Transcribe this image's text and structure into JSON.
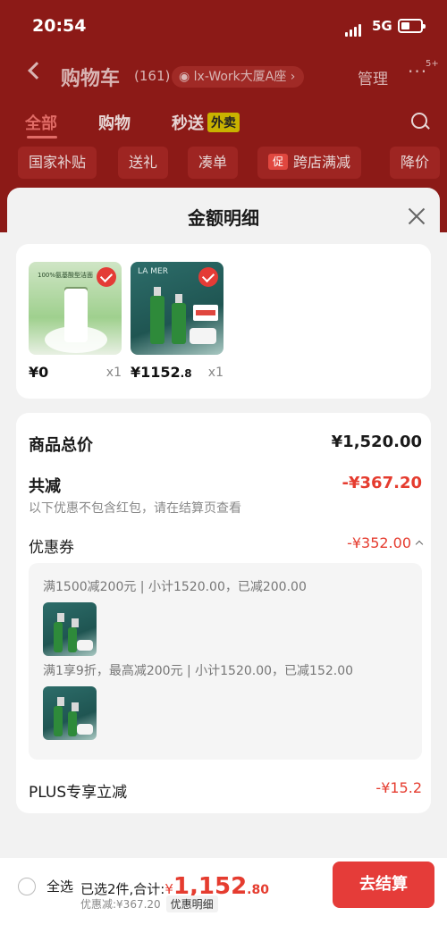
{
  "status_bar": {
    "time": "20:54",
    "network": "5G"
  },
  "header": {
    "title": "购物车",
    "count": "(161)",
    "address": "lx-Work大厦A座",
    "manage": "管理",
    "more_badge": "5+"
  },
  "tabs": [
    {
      "label": "全部"
    },
    {
      "label": "购物"
    },
    {
      "label": "秒送",
      "badge": "外卖"
    }
  ],
  "chips": [
    {
      "label": "国家补贴"
    },
    {
      "label": "送礼"
    },
    {
      "label": "凑单"
    },
    {
      "label": "跨店满减",
      "badge": "促"
    },
    {
      "label": "降价"
    }
  ],
  "sheet": {
    "title": "金额明细",
    "products": [
      {
        "price": "¥0",
        "qty": "x1",
        "thumb_text": "100%氨基酸型洁面"
      },
      {
        "price_int": "¥1152",
        "price_dec": ".8",
        "qty": "x1",
        "thumb_text": "LA MER"
      }
    ],
    "total_label": "商品总价",
    "total_value": "¥1,520.00",
    "reduce_label": "共减",
    "reduce_value": "-¥367.20",
    "reduce_note": "以下优惠不包含红包，请在结算页查看",
    "coupon_label": "优惠券",
    "coupon_value": "-¥352.00",
    "coupon_lines": [
      "满1500减200元 | 小计1520.00，已减200.00",
      "满1享9折，最高减200元 | 小计1520.00，已减152.00"
    ],
    "plus_label": "PLUS专享立减",
    "plus_value": "-¥15.2"
  },
  "bottom_bar": {
    "select_all": "全选",
    "selected_text": "已选2件,合计:",
    "total_yen": "¥",
    "total_int": "1,152",
    "total_dec": ".80",
    "discount_text": "优惠减:¥367.20",
    "detail_tag": "优惠明细",
    "checkout": "去结算"
  },
  "colors": {
    "accent": "#e53c2f",
    "header_bg": "#8c1a17",
    "checkout_bg": "#e53c39"
  }
}
